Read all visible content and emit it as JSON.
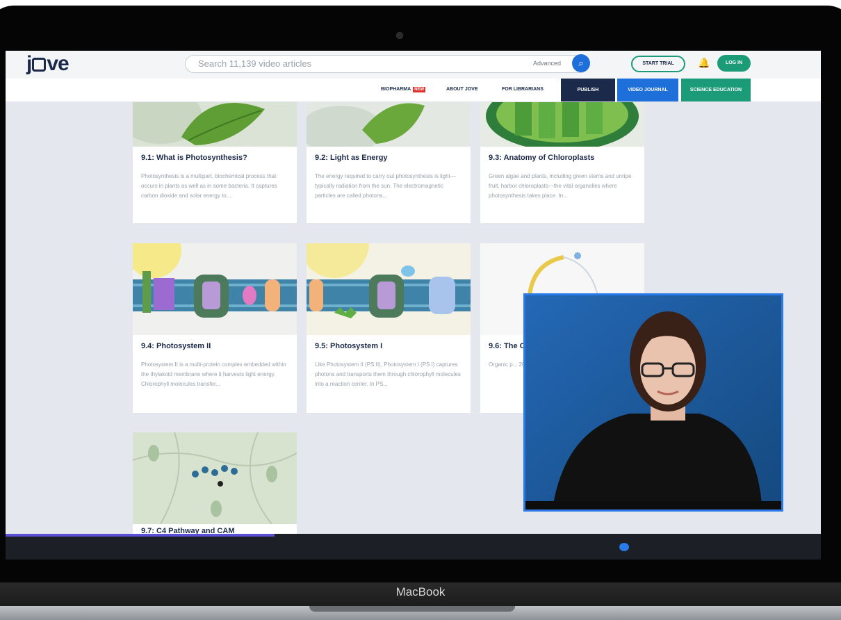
{
  "device": {
    "label": "MacBook"
  },
  "header": {
    "logo": "jove",
    "search_placeholder": "Search 11,139 video articles",
    "advanced_label": "Advanced",
    "start_trial": "START TRIAL",
    "login": "LOG IN"
  },
  "nav": {
    "biopharma": "BIOPHARMA",
    "new_badge": "NEW",
    "about": "ABOUT JOVE",
    "librarians": "FOR LIBRARIANS",
    "publish": "PUBLISH",
    "video_journal": "VIDEO JOURNAL",
    "science_education": "SCIENCE EDUCATION"
  },
  "cards": [
    {
      "title": "9.1: What is Photosynthesis?",
      "desc": "Photosynthesis is a multipart, biochemical process that occurs in plants as well as in some bacteria. It captures carbon dioxide and solar energy to..."
    },
    {
      "title": "9.2: Light as Energy",
      "desc": "The energy required to carry out photosynthesis is light—typically radiation from the sun. The electromagnetic particles are called photons..."
    },
    {
      "title": "9.3: Anatomy of Chloroplasts",
      "desc": "Green algae and plants, including green stems and unripe fruit, harbor chloroplasts—the vital organelles where photosynthesis takes place. In..."
    },
    {
      "title": "9.4: Photosystem II",
      "desc": "Photosystem II is a multi-protein complex embedded within the thylakoid membrane where it harvests light energy. Chlorophyll molecules transfer..."
    },
    {
      "title": "9.5: Photosystem I",
      "desc": "Like Photosystem II (PS II), Photosystem I (PS I) captures photons and transports them through chlorophyll molecules into a reaction center. In PS..."
    },
    {
      "title": "9.6: The C",
      "desc": "Organic p... 200 billion... to organic... approximat..."
    },
    {
      "title": "9.7: C4 Pathway and CAM",
      "desc": ""
    }
  ],
  "player": {
    "progress": 0.33
  }
}
